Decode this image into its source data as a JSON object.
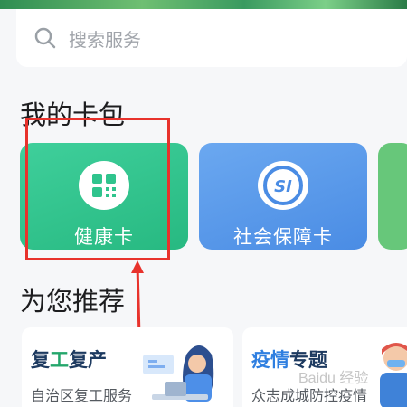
{
  "search": {
    "placeholder": "搜索服务",
    "icon": "search-icon"
  },
  "wallet": {
    "title": "我的卡包",
    "cards": [
      {
        "label": "健康卡",
        "icon": "qr-code-icon",
        "color": "#2fc48d"
      },
      {
        "label": "社会保障卡",
        "icon": "social-security-icon",
        "color": "#5a9bea"
      },
      {
        "label": "",
        "icon": "",
        "color": "#67c77a"
      }
    ]
  },
  "recommend": {
    "title": "为您推荐",
    "items": [
      {
        "title_part1": "复",
        "title_part2": "工",
        "title_part3": "复产",
        "subtitle": "自治区复工服务"
      },
      {
        "title_part1": "疫情",
        "title_part2": "专题",
        "subtitle": "众志成城防控疫情"
      }
    ]
  },
  "watermark": "Baidu 经验",
  "colors": {
    "highlight": "#e8322c",
    "accent_green": "#24a66b",
    "accent_blue": "#2f7fe0"
  }
}
